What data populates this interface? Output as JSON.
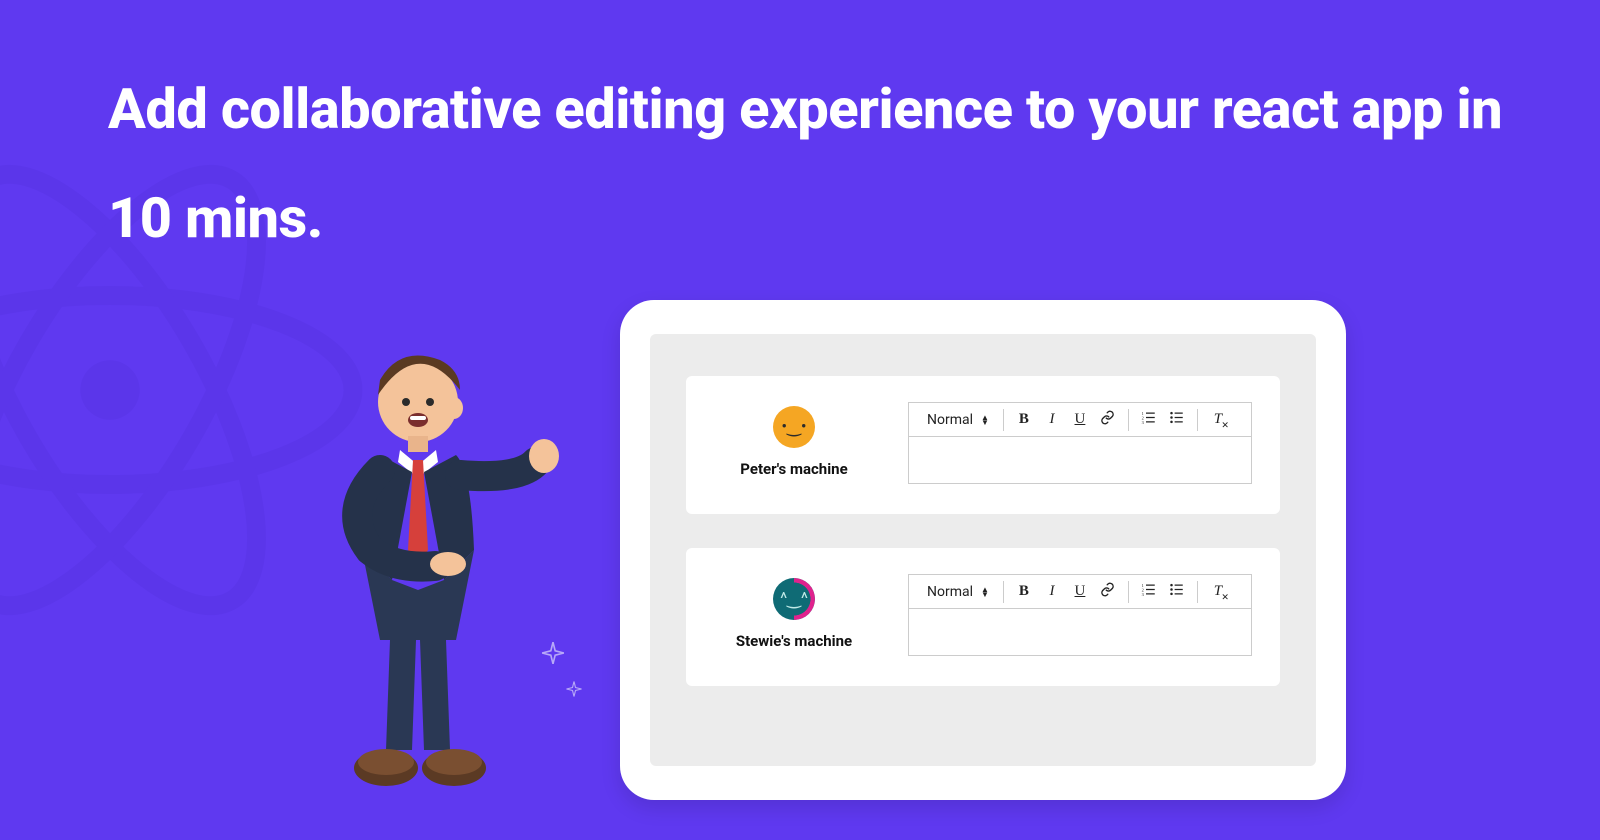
{
  "headline": "Add collaborative editing experience to your react app in 10 mins.",
  "editors": [
    {
      "avatar_class": "avatar1",
      "label": "Peter's machine",
      "style_label": "Normal"
    },
    {
      "avatar_class": "avatar2",
      "label": "Stewie's machine",
      "style_label": "Normal"
    }
  ],
  "toolbar_icons": {
    "bold": "B",
    "italic": "I",
    "underline": "U",
    "clear": "T"
  }
}
